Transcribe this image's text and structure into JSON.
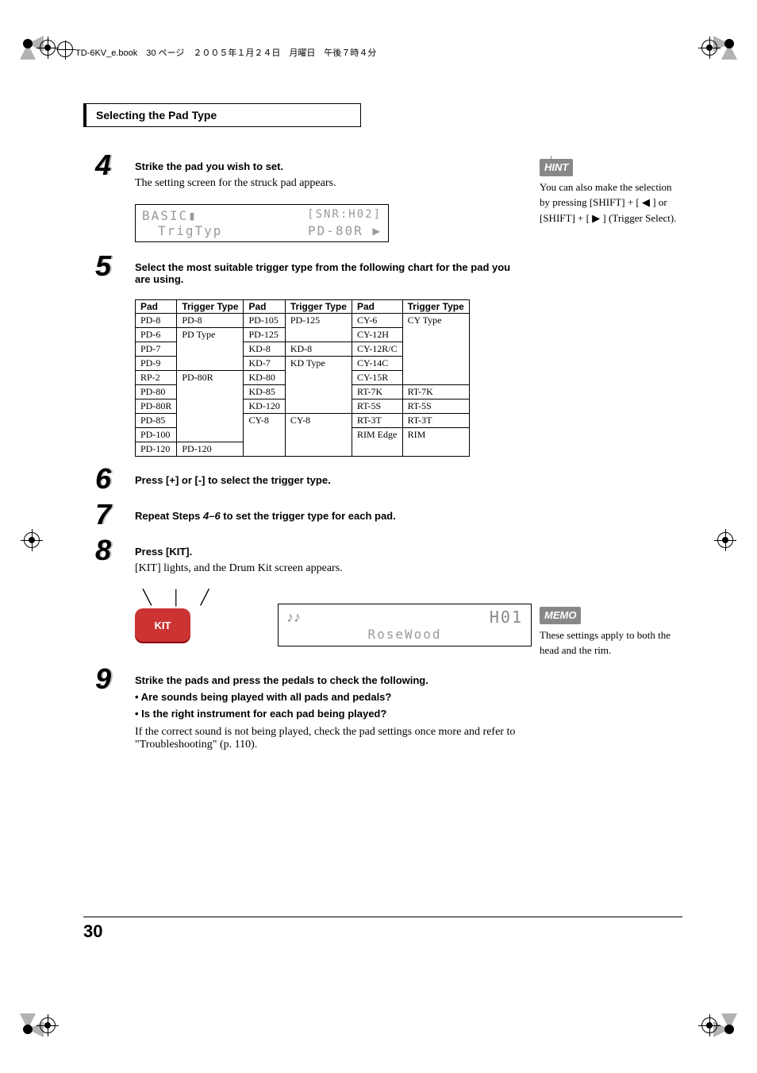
{
  "header": {
    "file_line": "TD-6KV_e.book　30 ページ　２００５年１月２４日　月曜日　午後７時４分"
  },
  "section_title": "Selecting the Pad Type",
  "side": {
    "hint_label": "HINT",
    "hint_text": "You can also make the selection by pressing [SHIFT] + [ ◀ ] or [SHIFT] + [ ▶ ] (Trigger Select).",
    "memo_label": "MEMO",
    "memo_text": "These settings apply to both the head and the rim."
  },
  "steps": {
    "s4": {
      "num": "4",
      "bold": "Strike the pad you wish to set.",
      "text": "The setting screen for the struck pad appears."
    },
    "lcd1": {
      "r1a": "BASIC▮",
      "r1b": "[SNR:H02]",
      "r2a": "TrigTyp",
      "r2b": "PD-80R ▶"
    },
    "s5": {
      "num": "5",
      "bold": "Select the most suitable trigger type from the following chart for the pad you are using."
    },
    "s6": {
      "num": "6",
      "bold": "Press [+] or [-] to select the trigger type."
    },
    "s7": {
      "num": "7",
      "bold_pre": "Repeat Steps ",
      "bold_range": "4–6",
      "bold_post": " to set the trigger type for each pad."
    },
    "s8": {
      "num": "8",
      "bold": "Press [KIT].",
      "text": "[KIT] lights, and the Drum Kit screen appears."
    },
    "kit_button": "KIT",
    "lcd2": {
      "icon": "♪♪",
      "name": "RoseWood",
      "num": "H01"
    },
    "s9": {
      "num": "9",
      "bold": "Strike the pads and press the pedals to check the following.",
      "bullet1": "• Are sounds being played with all pads and pedals?",
      "bullet2": "• Is the right instrument for each pad being played?",
      "text": "If the correct sound is not being played, check the pad settings once more and refer to \"Troubleshooting\" (p. 110)."
    }
  },
  "table": {
    "headers": [
      "Pad",
      "Trigger Type",
      "Pad",
      "Trigger Type",
      "Pad",
      "Trigger Type"
    ],
    "rows": [
      [
        "PD-8",
        "PD-8",
        "PD-105",
        "PD-125",
        "CY-6",
        "CY Type"
      ],
      [
        "PD-6",
        "PD Type",
        "PD-125",
        "",
        "CY-12H",
        ""
      ],
      [
        "PD-7",
        "",
        "KD-8",
        "KD-8",
        "CY-12R/C",
        ""
      ],
      [
        "PD-9",
        "",
        "KD-7",
        "KD Type",
        "CY-14C",
        ""
      ],
      [
        "RP-2",
        "PD-80R",
        "KD-80",
        "",
        "CY-15R",
        ""
      ],
      [
        "PD-80",
        "",
        "KD-85",
        "",
        "RT-7K",
        "RT-7K"
      ],
      [
        "PD-80R",
        "",
        "KD-120",
        "",
        "RT-5S",
        "RT-5S"
      ],
      [
        "PD-85",
        "",
        "CY-8",
        "CY-8",
        "RT-3T",
        "RT-3T"
      ],
      [
        "PD-100",
        "",
        "",
        "",
        "RIM Edge",
        "RIM"
      ],
      [
        "PD-120",
        "PD-120",
        "",
        "",
        "",
        ""
      ]
    ]
  },
  "page_number": "30"
}
